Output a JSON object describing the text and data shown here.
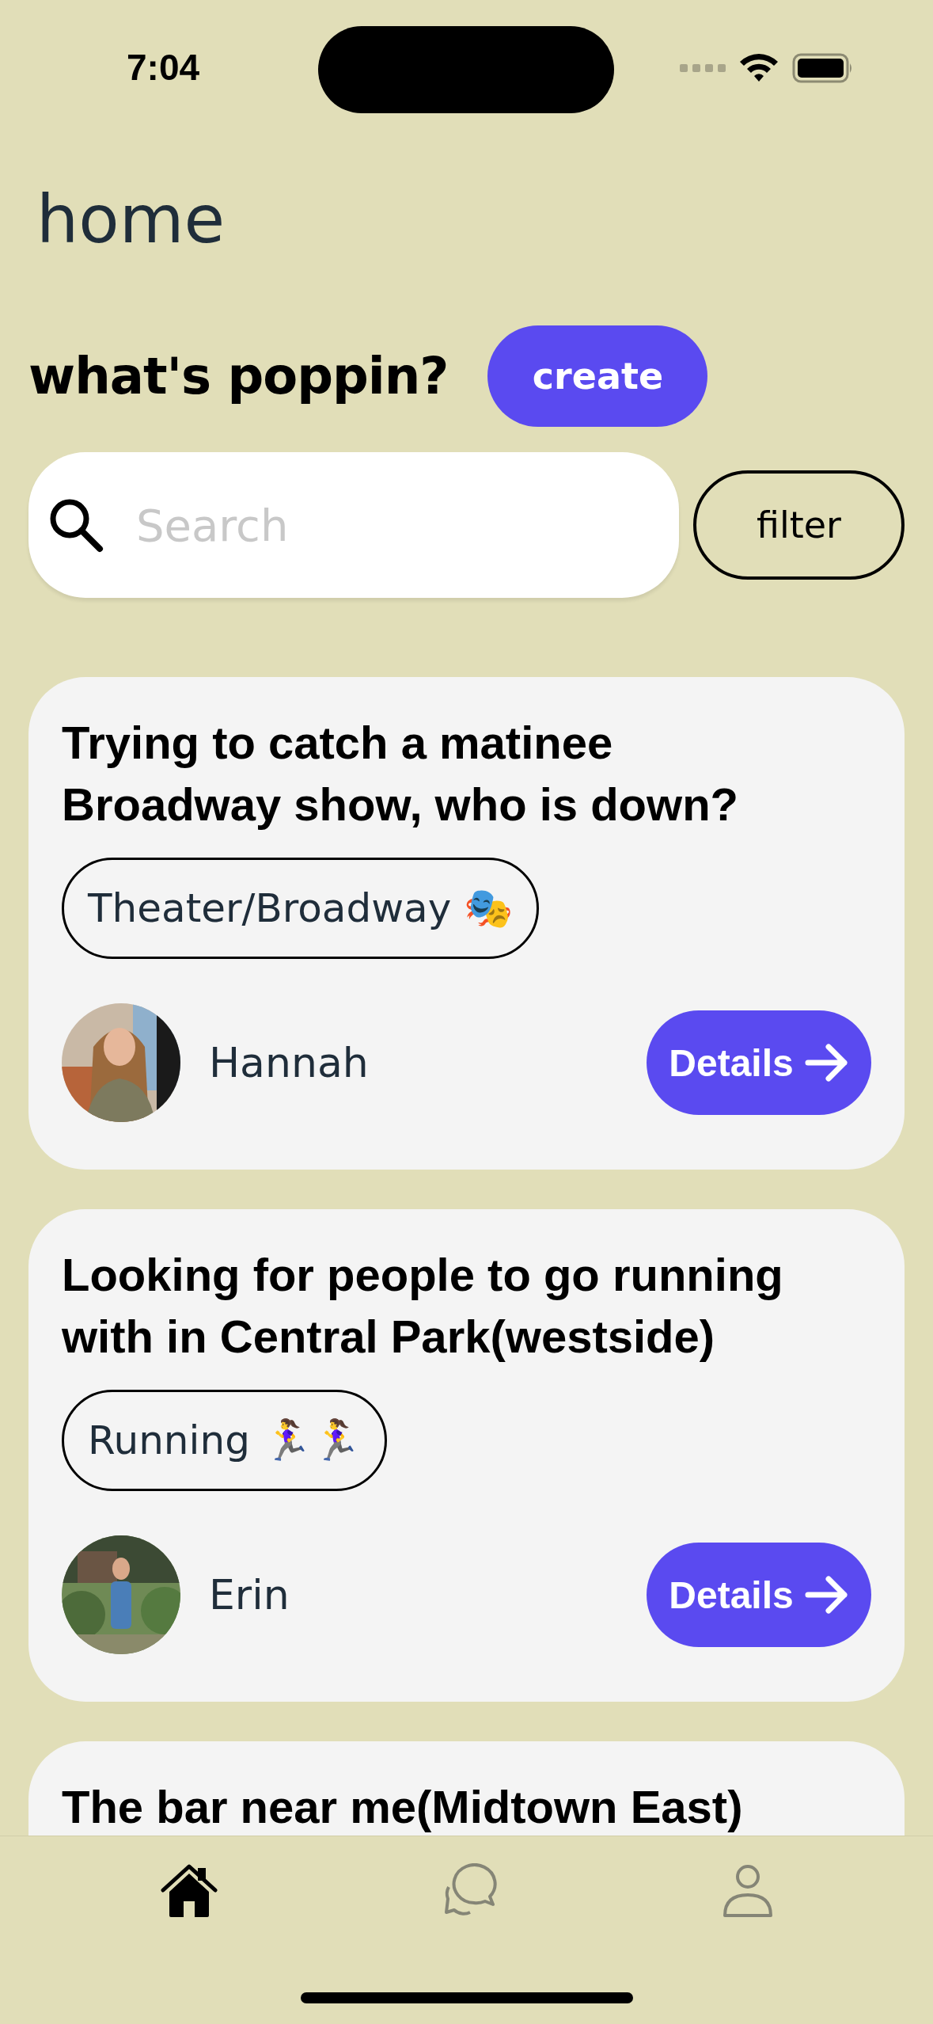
{
  "status_bar": {
    "time": "7:04"
  },
  "header": {
    "title": "home"
  },
  "prompt": {
    "heading": "what's poppin?",
    "create_button": "create"
  },
  "search": {
    "placeholder": "Search"
  },
  "filter_button": "filter",
  "posts": [
    {
      "title": "Trying to catch a matinee Broadway show, who is down?",
      "tag": "Theater/Broadway 🎭",
      "author": "Hannah",
      "button": "Details"
    },
    {
      "title": "Looking for people to go running with in Central Park(westside)",
      "tag": "Running 🏃‍♀️🏃‍♀️",
      "author": "Erin",
      "button": "Details"
    },
    {
      "title": "The bar near me(Midtown East)"
    }
  ],
  "tab_bar": [
    {
      "kind": "home",
      "selected": true
    },
    {
      "kind": "chat",
      "selected": false
    },
    {
      "kind": "profile",
      "selected": false
    }
  ]
}
